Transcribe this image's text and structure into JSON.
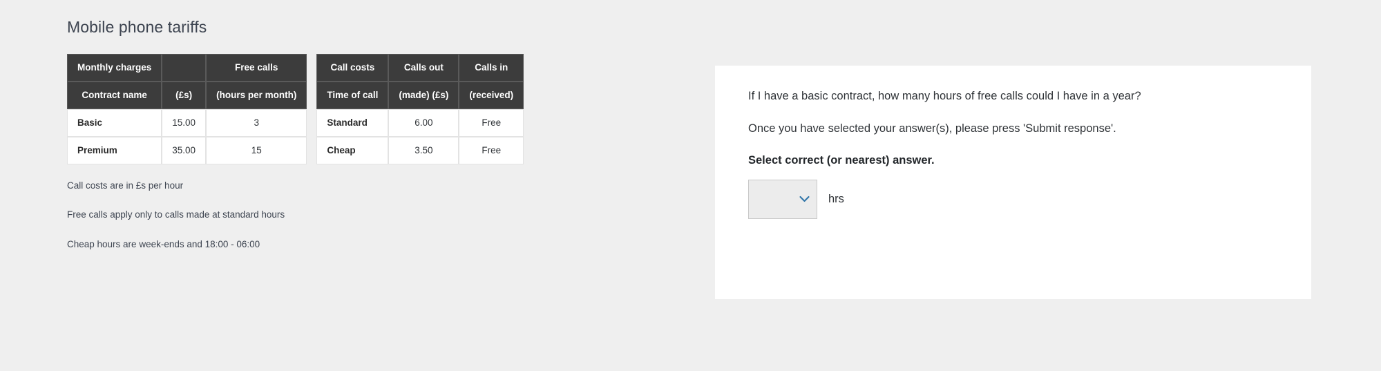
{
  "page": {
    "title": "Mobile phone tariffs",
    "background_color": "#efefef",
    "header_color": "#3c3c3c",
    "accent_color": "#2e74a8"
  },
  "tables": [
    {
      "name": "monthly-charges-table",
      "group_headers": [
        "Monthly charges",
        "",
        "Free calls"
      ],
      "column_headers": [
        "Contract name",
        "(£s)",
        "(hours per month)"
      ],
      "rows": [
        [
          "Basic",
          "15.00",
          "3"
        ],
        [
          "Premium",
          "35.00",
          "15"
        ]
      ]
    },
    {
      "name": "call-costs-table",
      "group_headers": [
        "Call costs",
        "Calls out",
        "Calls in"
      ],
      "column_headers": [
        "Time of call",
        "(made) (£s)",
        "(received)"
      ],
      "rows": [
        [
          "Standard",
          "6.00",
          "Free"
        ],
        [
          "Cheap",
          "3.50",
          "Free"
        ]
      ]
    }
  ],
  "footnotes": [
    "Call costs are in £s per hour",
    "Free calls apply only to calls made at standard hours",
    "Cheap hours are week-ends and 18:00 - 06:00"
  ],
  "answer_panel": {
    "question": "If I have a basic contract, how many hours of free calls could I have in a year?",
    "instruction": "Once you have selected your answer(s), please press 'Submit response'.",
    "prompt": "Select correct (or nearest) answer.",
    "select": {
      "selected_value": "",
      "options": [
        ""
      ]
    },
    "unit_label": "hrs",
    "chevron_icon": "chevron-down-icon"
  }
}
